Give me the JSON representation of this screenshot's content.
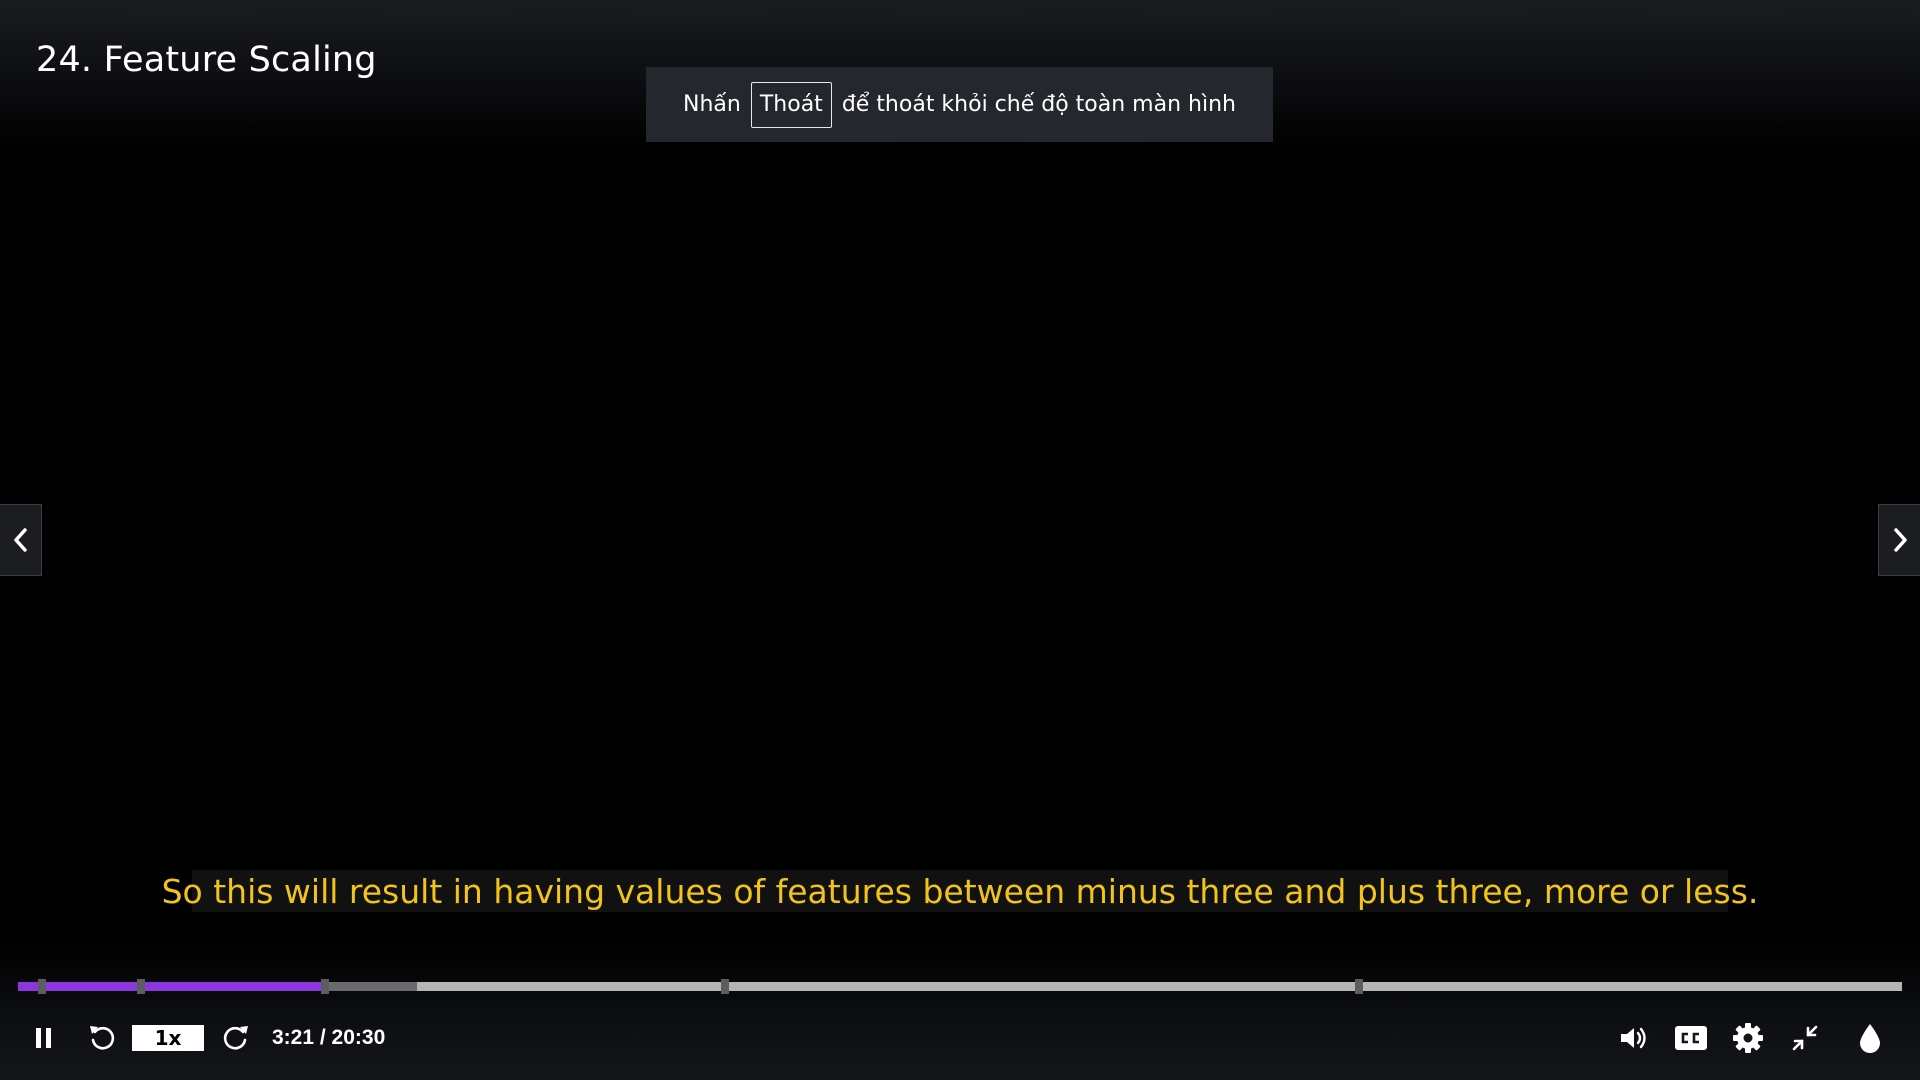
{
  "video": {
    "title": "24. Feature Scaling"
  },
  "fullscreen_notice": {
    "before": "Nhấn",
    "key": "Thoát",
    "after": "để thoát khỏi chế độ toàn màn hình"
  },
  "caption": {
    "text": "So this will result in having values of features between minus three and plus three, more or less.",
    "color": "#f2c31a"
  },
  "player": {
    "current_time": "3:21",
    "duration": "20:30",
    "time_display": "3:21 / 20:30",
    "speed_label": "1x",
    "progress_fraction": 0.163,
    "buffered_fraction": 0.212,
    "chapter_markers": [
      0.0655,
      0.1632,
      0.3755,
      0.7116
    ],
    "accent_color": "#8c36e0"
  },
  "icons": {
    "pause": "pause-icon",
    "rewind": "rewind-icon",
    "forward": "forward-icon",
    "volume": "volume-icon",
    "captions": "captions-icon",
    "settings": "gear-icon",
    "exit_fullscreen": "exit-fullscreen-icon",
    "theme": "droplet-icon",
    "prev": "chevron-left-icon",
    "next": "chevron-right-icon"
  }
}
